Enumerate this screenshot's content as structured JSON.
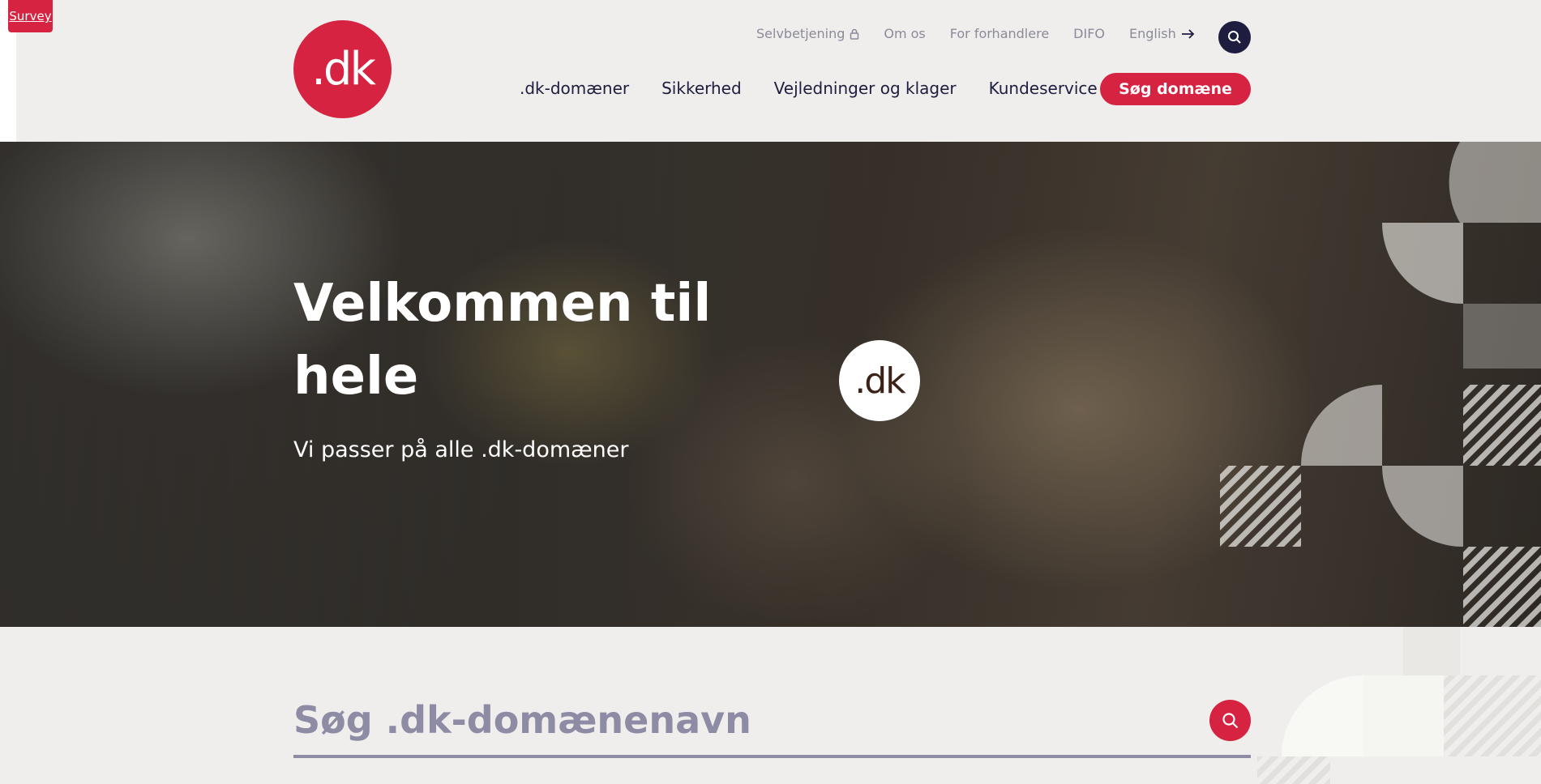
{
  "survey": {
    "label": "Survey"
  },
  "logo": {
    "text": ".dk"
  },
  "utility_nav": [
    {
      "label": "Selvbetjening",
      "icon": "lock-icon"
    },
    {
      "label": "Om os"
    },
    {
      "label": "For forhandlere"
    },
    {
      "label": "DIFO"
    },
    {
      "label": "English",
      "icon": "arrow-right-icon"
    }
  ],
  "main_nav": [
    {
      "label": ".dk-domæner"
    },
    {
      "label": "Sikkerhed"
    },
    {
      "label": "Vejledninger og klager"
    },
    {
      "label": "Kundeservice"
    }
  ],
  "cta": {
    "label": "Søg domæne"
  },
  "hero": {
    "title": "Velkommen til hele",
    "subtitle": "Vi passer på alle .dk-domæner",
    "badge": ".dk"
  },
  "search": {
    "placeholder": "Søg .dk-domænenavn"
  },
  "colors": {
    "brand_red": "#d62341",
    "navy": "#1f1d3f",
    "background": "#efeeec",
    "muted": "#8e8ba4"
  },
  "icons": {
    "top_search": "search-icon",
    "search_submit": "search-icon"
  }
}
